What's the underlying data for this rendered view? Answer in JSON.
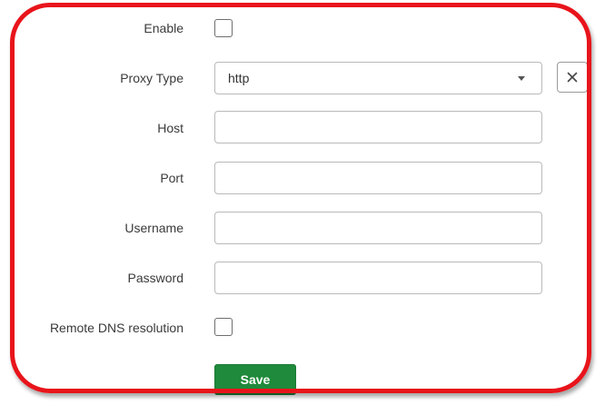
{
  "form": {
    "enable": {
      "label": "Enable",
      "checked": false
    },
    "proxy_type": {
      "label": "Proxy Type",
      "value": "http"
    },
    "host": {
      "label": "Host",
      "value": ""
    },
    "port": {
      "label": "Port",
      "value": ""
    },
    "username": {
      "label": "Username",
      "value": ""
    },
    "password": {
      "label": "Password",
      "value": ""
    },
    "remote_dns": {
      "label": "Remote DNS resolution",
      "checked": false
    },
    "save_label": "Save"
  },
  "icons": {
    "proxy_type_dropdown": "chevron-down-icon",
    "proxy_type_clear": "close-icon"
  },
  "colors": {
    "highlight_border": "#e8141b",
    "save_button": "#1f8a3b"
  }
}
